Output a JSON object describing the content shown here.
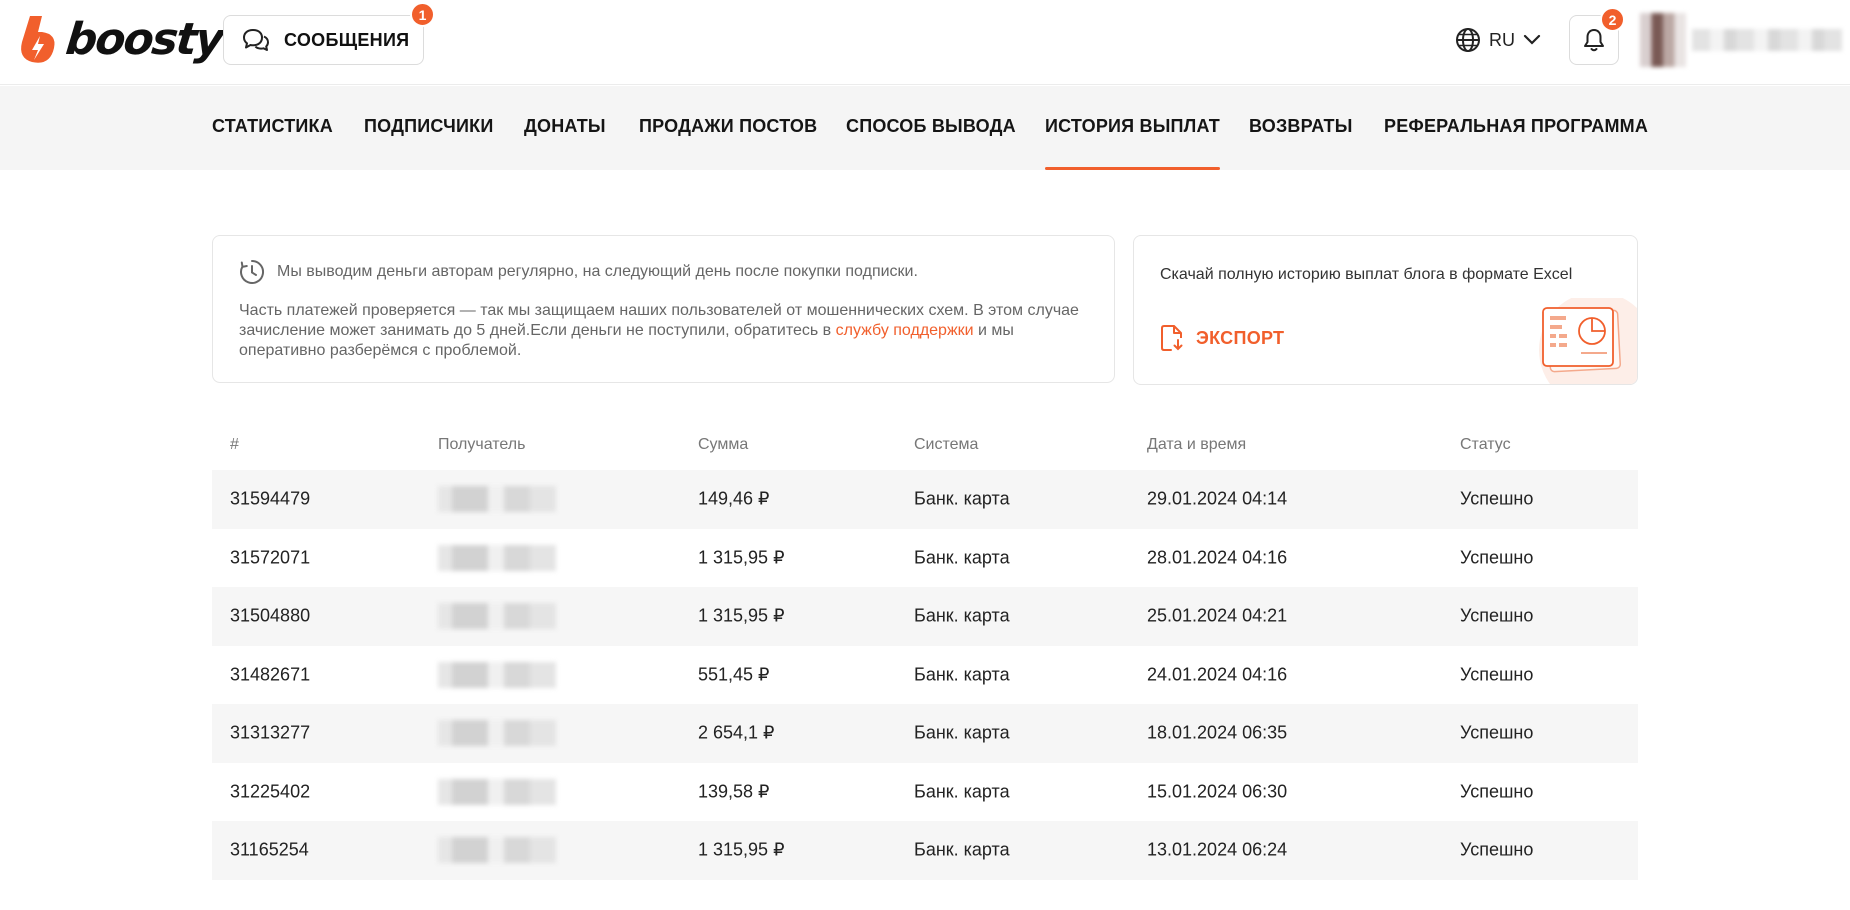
{
  "header": {
    "logo_text": "boosty",
    "messages_label": "СООБЩЕНИЯ",
    "messages_badge": "1",
    "language": "RU",
    "notifications_badge": "2"
  },
  "nav": {
    "tabs": [
      {
        "label": "СТАТИСТИКА",
        "active": false
      },
      {
        "label": "ПОДПИСЧИКИ",
        "active": false
      },
      {
        "label": "ДОНАТЫ",
        "active": false
      },
      {
        "label": "ПРОДАЖИ ПОСТОВ",
        "active": false
      },
      {
        "label": "СПОСОБ ВЫВОДА",
        "active": false
      },
      {
        "label": "ИСТОРИЯ ВЫПЛАТ",
        "active": true
      },
      {
        "label": "ВОЗВРАТЫ",
        "active": false
      },
      {
        "label": "РЕФЕРАЛЬНАЯ ПРОГРАММА",
        "active": false
      }
    ]
  },
  "info": {
    "headline": "Мы выводим деньги авторам регулярно, на следующий день после покупки подписки.",
    "body_before": "Часть платежей проверяется — так мы защищаем наших пользователей от мошеннических схем. В этом случае зачисление может занимать до 5 дней.Если деньги не поступили, обратитесь в ",
    "support_link": "службу поддержки",
    "body_after": " и мы оперативно разберёмся с проблемой."
  },
  "export": {
    "text": "Скачай полную историю выплат блога в формате Excel",
    "button_label": "ЭКСПОРТ"
  },
  "table": {
    "headers": [
      "#",
      "Получатель",
      "Сумма",
      "Система",
      "Дата и время",
      "Статус"
    ],
    "rows": [
      {
        "id": "31594479",
        "amount": "149,46 ₽",
        "system": "Банк. карта",
        "datetime": "29.01.2024 04:14",
        "status": "Успешно"
      },
      {
        "id": "31572071",
        "amount": "1 315,95 ₽",
        "system": "Банк. карта",
        "datetime": "28.01.2024 04:16",
        "status": "Успешно"
      },
      {
        "id": "31504880",
        "amount": "1 315,95 ₽",
        "system": "Банк. карта",
        "datetime": "25.01.2024 04:21",
        "status": "Успешно"
      },
      {
        "id": "31482671",
        "amount": "551,45 ₽",
        "system": "Банк. карта",
        "datetime": "24.01.2024 04:16",
        "status": "Успешно"
      },
      {
        "id": "31313277",
        "amount": "2 654,1 ₽",
        "system": "Банк. карта",
        "datetime": "18.01.2024 06:35",
        "status": "Успешно"
      },
      {
        "id": "31225402",
        "amount": "139,58 ₽",
        "system": "Банк. карта",
        "datetime": "15.01.2024 06:30",
        "status": "Успешно"
      },
      {
        "id": "31165254",
        "amount": "1 315,95 ₽",
        "system": "Банк. карта",
        "datetime": "13.01.2024 06:24",
        "status": "Успешно"
      }
    ]
  },
  "colors": {
    "accent": "#f15f2c",
    "nav_bg": "#f5f5f5",
    "row_alt": "#f6f6f6"
  },
  "icons": [
    "boosty-logo-icon",
    "chat-bubbles-icon",
    "globe-icon",
    "chevron-down-icon",
    "bell-icon",
    "clock-icon",
    "document-download-icon",
    "report-illustration-icon"
  ]
}
